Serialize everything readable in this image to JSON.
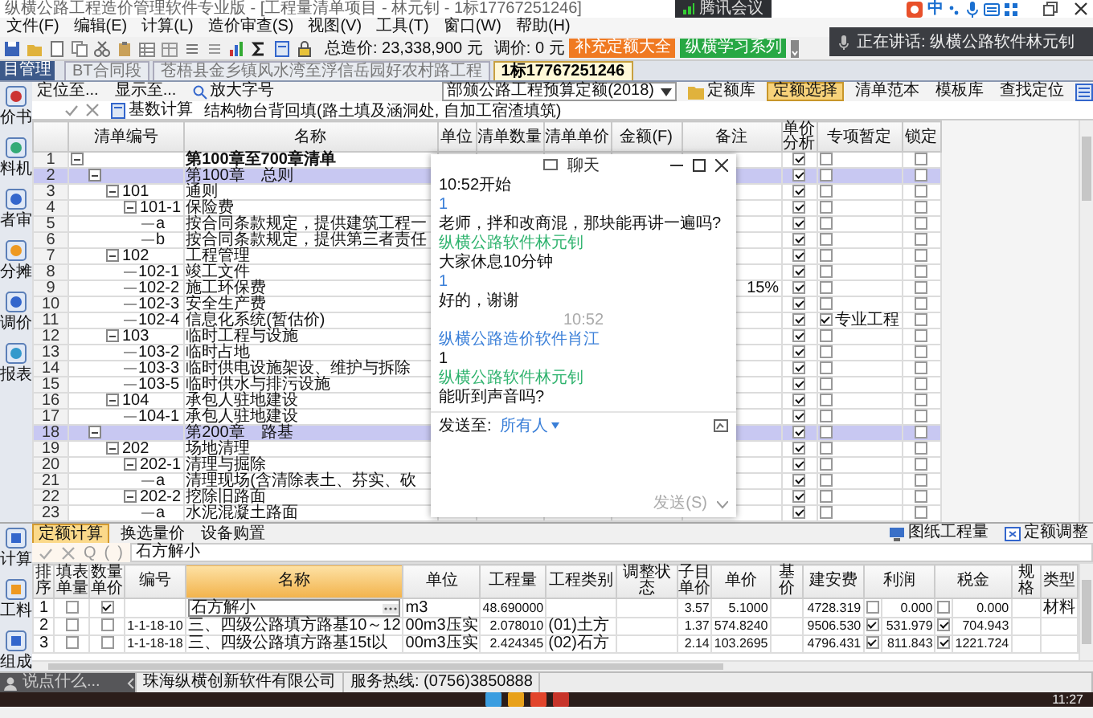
{
  "window": {
    "title": "纵横公路工程造价管理软件专业版 - [工程量清单项目 - 林元钊 - 1标17767251246]"
  },
  "meeting_badge": {
    "label": "腾讯会议"
  },
  "ime": {
    "label": "中"
  },
  "menu": [
    "文件(F)",
    "编辑(E)",
    "计算(L)",
    "造价审查(S)",
    "视图(V)",
    "工具(T)",
    "窗口(W)",
    "帮助(H)"
  ],
  "toolbar": {
    "total": "总造价: 23,338,900 元",
    "adjust": "调价: 0 元",
    "buttons": [
      {
        "label": "补充定额大全",
        "color": "#f07a22"
      },
      {
        "label": "纵横学习系列",
        "color": "#27a844"
      }
    ]
  },
  "speaking": {
    "text": "正在讲话: 纵横公路软件林元钊"
  },
  "side_tab": {
    "label": "目管理"
  },
  "doc_tabs": [
    {
      "label": "BT合同段",
      "selected": false
    },
    {
      "label": "苍梧县金乡镇风水湾至浮信岳园好农村路工程",
      "selected": false
    },
    {
      "label": "1标17767251246",
      "selected": true
    }
  ],
  "nav": {
    "locate": "定位至...",
    "show": "显示至...",
    "zoom": "放大字号",
    "quota_set": "部颁公路工程预算定额(2018)",
    "quota_lib": "定额库",
    "buttons": [
      {
        "label": "定额选择",
        "selected": true
      },
      {
        "label": "清单范本",
        "selected": false
      },
      {
        "label": "模板库",
        "selected": false
      },
      {
        "label": "查找定位",
        "selected": false
      }
    ]
  },
  "formula_bar": {
    "calc": "基数计算",
    "text": "结构物台背回填(路土填及涵洞处, 自加工宿渣填筑)"
  },
  "sidebar": {
    "top": [
      "价书",
      "料机",
      "者审",
      "分摊",
      "调价",
      "报表"
    ],
    "bottom": [
      "计算",
      "工料",
      "组成"
    ]
  },
  "bill_table": {
    "columns": [
      "清单编号",
      "名称",
      "单位",
      "清单数量",
      "清单单价",
      "金额(F)",
      "备注",
      "单价分析",
      "专项暂定",
      "锁定"
    ],
    "rows": [
      {
        "number": "1",
        "name": "第100章至700章清单",
        "kind": "root",
        "expanded": true,
        "unit_analysis": true,
        "special": false,
        "locked": false,
        "children": [
          {
            "number": "2",
            "name": "第100章　总则",
            "kind": "chapter",
            "expanded": true,
            "unit_analysis": true,
            "special": false,
            "locked": false,
            "children": [
              {
                "number": "3",
                "code": "101",
                "name": "通则",
                "kind": "item",
                "expanded": true,
                "unit_analysis": true,
                "special": false,
                "locked": false,
                "children": [
                  {
                    "number": "4",
                    "code": "101-1",
                    "name": "保险费",
                    "kind": "item",
                    "expanded": true,
                    "unit_analysis": true,
                    "special": false,
                    "locked": false,
                    "children": [
                      {
                        "number": "5",
                        "code": "a",
                        "name": "按合同条款规定，提供建筑工程一",
                        "kind": "item",
                        "unit_analysis": true,
                        "special": false,
                        "locked": false
                      },
                      {
                        "number": "6",
                        "code": "b",
                        "name": "按合同条款规定，提供第三者责任",
                        "kind": "item",
                        "unit_analysis": true,
                        "special": false,
                        "locked": false
                      }
                    ]
                  }
                ]
              },
              {
                "number": "7",
                "code": "102",
                "name": "工程管理",
                "kind": "item",
                "expanded": true,
                "unit_analysis": true,
                "special": false,
                "locked": false,
                "children": [
                  {
                    "number": "8",
                    "code": "102-1",
                    "name": "竣工文件",
                    "kind": "item",
                    "unit_analysis": true,
                    "special": false,
                    "locked": false
                  },
                  {
                    "number": "9",
                    "code": "102-2",
                    "name": "施工环保费",
                    "kind": "item",
                    "remark": "15%",
                    "unit_analysis": true,
                    "special": false,
                    "locked": false
                  },
                  {
                    "number": "10",
                    "code": "102-3",
                    "name": "安全生产费",
                    "kind": "item",
                    "unit_analysis": true,
                    "special": false,
                    "locked": false
                  },
                  {
                    "number": "11",
                    "code": "102-4",
                    "name": "信息化系统(暂估价)",
                    "kind": "item",
                    "unit_analysis": true,
                    "special": true,
                    "special_note": "专业工程",
                    "locked": false
                  }
                ]
              },
              {
                "number": "12",
                "code": "103",
                "name": "临时工程与设施",
                "kind": "item",
                "expanded": true,
                "unit_analysis": true,
                "special": false,
                "locked": false,
                "children": [
                  {
                    "number": "13",
                    "code": "103-2",
                    "name": "临时占地",
                    "kind": "item",
                    "unit_analysis": true,
                    "special": false,
                    "locked": false
                  },
                  {
                    "number": "14",
                    "code": "103-3",
                    "name": "临时供电设施架设、维护与拆除",
                    "kind": "item",
                    "unit_analysis": true,
                    "special": false,
                    "locked": false
                  },
                  {
                    "number": "15",
                    "code": "103-5",
                    "name": "临时供水与排污设施",
                    "kind": "item",
                    "unit_analysis": true,
                    "special": false,
                    "locked": false
                  }
                ]
              },
              {
                "number": "16",
                "code": "104",
                "name": "承包人驻地建设",
                "kind": "item",
                "expanded": true,
                "unit_analysis": true,
                "special": false,
                "locked": false,
                "children": [
                  {
                    "number": "17",
                    "code": "104-1",
                    "name": "承包人驻地建设",
                    "kind": "item",
                    "unit_analysis": true,
                    "special": false,
                    "locked": false
                  }
                ]
              }
            ]
          },
          {
            "number": "18",
            "name": "第200章　路基",
            "kind": "chapter",
            "expanded": true,
            "unit_analysis": true,
            "special": false,
            "locked": false,
            "children": [
              {
                "number": "19",
                "code": "202",
                "name": "场地清理",
                "kind": "item",
                "expanded": true,
                "unit_analysis": true,
                "special": false,
                "locked": false,
                "children": [
                  {
                    "number": "20",
                    "code": "202-1",
                    "name": "清理与掘除",
                    "kind": "item",
                    "expanded": true,
                    "unit_analysis": true,
                    "special": false,
                    "locked": false,
                    "children": [
                      {
                        "number": "21",
                        "code": "a",
                        "name": "清理现场(含清除表土、芬实、砍",
                        "kind": "item",
                        "unit_analysis": true,
                        "special": false,
                        "locked": false
                      }
                    ]
                  },
                  {
                    "number": "22",
                    "code": "202-2",
                    "name": "挖除旧路面",
                    "kind": "item",
                    "expanded": true,
                    "unit_analysis": true,
                    "special": false,
                    "locked": false,
                    "children": [
                      {
                        "number": "23",
                        "code": "a",
                        "name": "水泥混凝土路面",
                        "kind": "item",
                        "unit_analysis": true,
                        "special": false,
                        "locked": false
                      }
                    ]
                  }
                ]
              }
            ]
          }
        ]
      }
    ]
  },
  "chat": {
    "title": "聊天",
    "messages": [
      {
        "kind": "text",
        "text": "10:52开始"
      },
      {
        "kind": "sender",
        "text": "1",
        "color": "#3a7fd8"
      },
      {
        "kind": "text",
        "text": "老师，拌和改商混，那块能再讲一遍吗?"
      },
      {
        "kind": "sender",
        "text": "纵横公路软件林元钊",
        "color": "#2fb36e"
      },
      {
        "kind": "text",
        "text": "大家休息10分钟"
      },
      {
        "kind": "sender",
        "text": "1",
        "color": "#3a7fd8"
      },
      {
        "kind": "text",
        "text": "好的，谢谢"
      },
      {
        "kind": "time",
        "text": "10:52"
      },
      {
        "kind": "sender",
        "text": "纵横公路造价软件肖江",
        "color": "#3a7fd8"
      },
      {
        "kind": "text",
        "text": "1"
      },
      {
        "kind": "sender",
        "text": "纵横公路软件林元钊",
        "color": "#2fb36e"
      },
      {
        "kind": "text",
        "text": "能听到声音吗?"
      }
    ],
    "send_to": "发送至:",
    "recipient": "所有人",
    "send": "发送(S)"
  },
  "meeting_input": {
    "placeholder": "说点什么..."
  },
  "quota_panel": {
    "tabs": [
      {
        "label": "定额计算",
        "selected": true
      },
      {
        "label": "换选量价",
        "selected": false
      },
      {
        "label": "设备购置",
        "selected": false
      }
    ],
    "tools": [
      "图纸工程量",
      "定额调整"
    ],
    "formula_symbols": [
      "Q",
      "(",
      ")"
    ],
    "formula": "石方解小",
    "columns": [
      {
        "label": "排序",
        "selected": false
      },
      {
        "label": "填表单量",
        "selected": false
      },
      {
        "label": "数量单价",
        "selected": false
      },
      {
        "label": "编号",
        "selected": false
      },
      {
        "label": "名称",
        "selected": true
      },
      {
        "label": "单位",
        "selected": false
      },
      {
        "label": "工程量",
        "selected": false
      },
      {
        "label": "工程类别",
        "selected": false
      },
      {
        "label": "调整状态",
        "selected": false
      },
      {
        "label": "子目单价",
        "selected": false
      },
      {
        "label": "单价",
        "selected": false
      },
      {
        "label": "基价",
        "selected": false
      },
      {
        "label": "建安费",
        "selected": false
      },
      {
        "label": "利润",
        "selected": false
      },
      {
        "label": "税金",
        "selected": false
      },
      {
        "label": "规格",
        "selected": false
      },
      {
        "label": "类型",
        "selected": false
      }
    ],
    "rows": [
      {
        "order": "1",
        "fill": false,
        "qty_price": true,
        "name": "石方解小",
        "editing": true,
        "unit": "m3",
        "quantity": "48.690000",
        "sub_price": "3.57",
        "price": "5.1000",
        "cost": "4728.319",
        "profit_on": false,
        "profit": "0.000",
        "tax_on": false,
        "tax": "0.000",
        "type": "材料"
      },
      {
        "order": "2",
        "fill": false,
        "qty_price": false,
        "code": "1-1-18-10",
        "name": "三、四级公路填方路基10～12",
        "editing": false,
        "unit": "00m3压实",
        "quantity": "2.078010",
        "category": "(01)土方",
        "sub_price": "1.37",
        "price": "574.8240",
        "cost": "9506.530",
        "profit_on": true,
        "profit": "531.979",
        "tax_on": true,
        "tax": "704.943"
      },
      {
        "order": "3",
        "fill": false,
        "qty_price": false,
        "code": "1-1-18-18",
        "name": "三、四级公路填方路基15t以",
        "editing": false,
        "unit": "00m3压实",
        "quantity": "2.424345",
        "category": "(02)石方",
        "sub_price": "2.14",
        "price": "103.2695",
        "cost": "4796.431",
        "profit_on": true,
        "profit": "811.843",
        "tax_on": true,
        "tax": "1221.724"
      }
    ]
  },
  "status_bar": {
    "company": "珠海纵横创新软件有限公司",
    "hotline": "服务热线: (0756)3850888"
  },
  "taskbar": {
    "time": "11:27"
  }
}
